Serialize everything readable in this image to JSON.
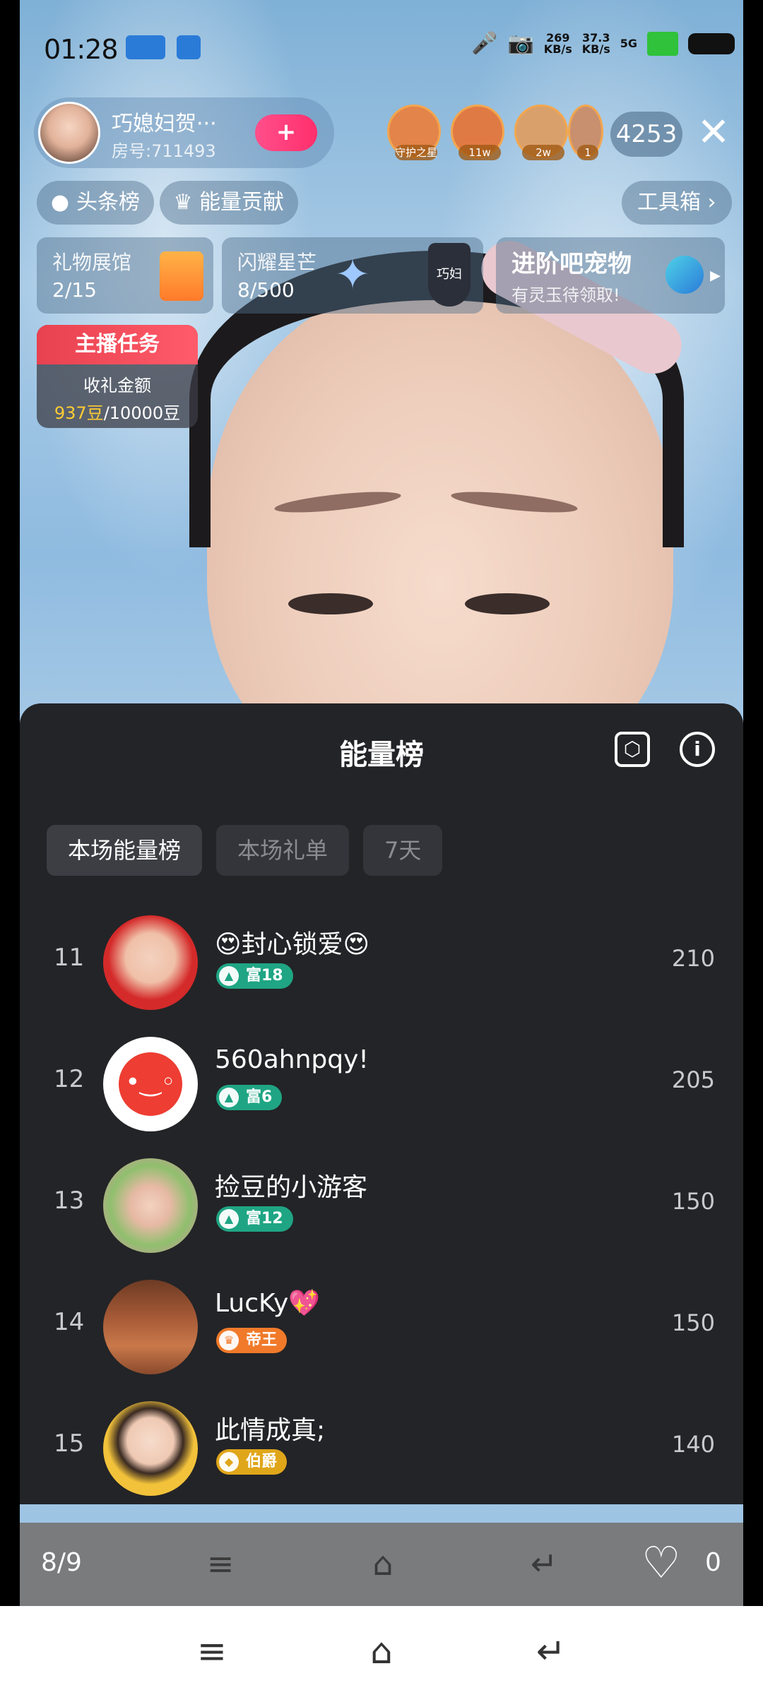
{
  "status_bar": {
    "time": "01:28",
    "net_down": "269",
    "net_down_unit": "KB/s",
    "net_up": "37.3",
    "net_up_unit": "KB/s",
    "signal_label": "5G"
  },
  "host": {
    "name": "巧媳妇贺···",
    "room": "房号:711493",
    "follow_label": "+"
  },
  "top_viewers": [
    {
      "badge": "守护之星",
      "color": "#e3844a"
    },
    {
      "badge": "11w",
      "color": "#e07a44"
    },
    {
      "badge": "2w",
      "color": "#d9a06b"
    },
    {
      "badge": "1",
      "color": "#c8906f"
    }
  ],
  "viewer_count": "4253",
  "chips": {
    "headline": "头条榜",
    "energy": "能量贡献",
    "toolbox": "工具箱 ›"
  },
  "cards": {
    "gift_hall": {
      "title": "礼物展馆",
      "value": "2/15"
    },
    "shine": {
      "title": "闪耀星芒",
      "value": "8/500"
    },
    "badge_text": "巧妇",
    "promo_title": "进阶吧宠物",
    "promo_sub": "有灵玉待领取!"
  },
  "task": {
    "title": "主播任务",
    "label": "收礼金额",
    "current": "937豆",
    "target": "/10000豆"
  },
  "panel": {
    "title": "能量榜",
    "tabs": [
      "本场能量榜",
      "本场礼单",
      "7天"
    ],
    "rows": [
      {
        "rank": "11",
        "name": "😍封心锁爱😍",
        "level": "富18",
        "level_color": "#1fa584",
        "score": "210",
        "avatar_color": "#d42a2a"
      },
      {
        "rank": "12",
        "name": "560ahnpqy!",
        "level": "富6",
        "level_color": "#1fa584",
        "score": "205",
        "avatar_color": "#ffffff"
      },
      {
        "rank": "13",
        "name": "捡豆的小游客",
        "level": "富12",
        "level_color": "#1fa584",
        "score": "150",
        "avatar_color": "#8fbf6d"
      },
      {
        "rank": "14",
        "name": "LucKy💖",
        "level": "帝王",
        "level_color": "#f07a2a",
        "score": "150",
        "avatar_color": "#a65a36"
      },
      {
        "rank": "15",
        "name": "此情成真;",
        "level": "伯爵",
        "level_color": "#e0a61a",
        "score": "140",
        "avatar_color": "#f2c23a"
      }
    ]
  },
  "bottom_bar": {
    "page": "8/9",
    "likes": "0"
  },
  "icons": {
    "settings": "hexagon-nut-icon",
    "info": "info-icon",
    "menu": "menu-icon",
    "home": "home-icon",
    "back": "back-icon",
    "heart": "heart-icon"
  }
}
